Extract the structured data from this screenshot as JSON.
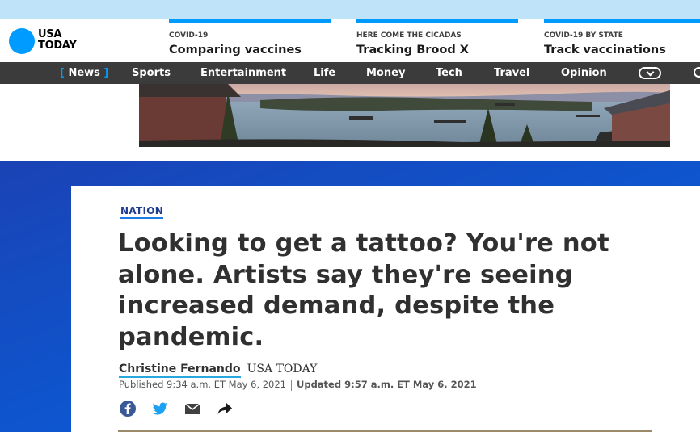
{
  "brand": {
    "line1": "USA",
    "line2": "TODAY",
    "accent": "#009bff"
  },
  "promos": [
    {
      "kicker": "COVID-19",
      "headline": "Comparing vaccines"
    },
    {
      "kicker": "HERE COME THE CICADAS",
      "headline": "Tracking Brood X"
    },
    {
      "kicker": "COVID-19 BY STATE",
      "headline": "Track vaccinations"
    }
  ],
  "nav": {
    "items": [
      "News",
      "Sports",
      "Entertainment",
      "Life",
      "Money",
      "Tech",
      "Travel",
      "Opinion"
    ],
    "active": "News",
    "bar_color": "#3b3b3b"
  },
  "icons": {
    "more": "chevron-down-icon",
    "search": "search-icon",
    "share": [
      "facebook-icon",
      "twitter-icon",
      "email-icon",
      "share-arrow-icon"
    ]
  },
  "article": {
    "section": "NATION",
    "title": "Looking to get a tattoo? You're not alone. Artists say they're seeing increased demand, despite the pandemic.",
    "author": "Christine Fernando",
    "outlet": "USA TODAY",
    "published": "Published 9:34 a.m. ET May 6, 2021",
    "updated": "Updated 9:57 a.m. ET May 6, 2021"
  }
}
